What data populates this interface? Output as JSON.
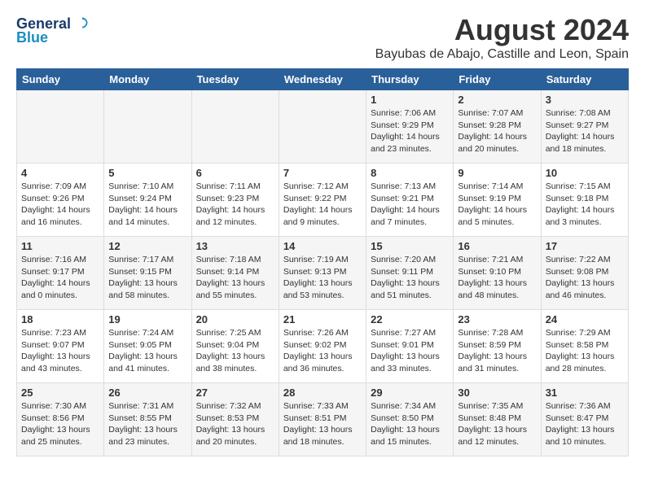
{
  "logo": {
    "line1": "General",
    "line2": "Blue"
  },
  "title": "August 2024",
  "subtitle": "Bayubas de Abajo, Castille and Leon, Spain",
  "days_of_week": [
    "Sunday",
    "Monday",
    "Tuesday",
    "Wednesday",
    "Thursday",
    "Friday",
    "Saturday"
  ],
  "weeks": [
    [
      {
        "day": "",
        "info": ""
      },
      {
        "day": "",
        "info": ""
      },
      {
        "day": "",
        "info": ""
      },
      {
        "day": "",
        "info": ""
      },
      {
        "day": "1",
        "info": "Sunrise: 7:06 AM\nSunset: 9:29 PM\nDaylight: 14 hours\nand 23 minutes."
      },
      {
        "day": "2",
        "info": "Sunrise: 7:07 AM\nSunset: 9:28 PM\nDaylight: 14 hours\nand 20 minutes."
      },
      {
        "day": "3",
        "info": "Sunrise: 7:08 AM\nSunset: 9:27 PM\nDaylight: 14 hours\nand 18 minutes."
      }
    ],
    [
      {
        "day": "4",
        "info": "Sunrise: 7:09 AM\nSunset: 9:26 PM\nDaylight: 14 hours\nand 16 minutes."
      },
      {
        "day": "5",
        "info": "Sunrise: 7:10 AM\nSunset: 9:24 PM\nDaylight: 14 hours\nand 14 minutes."
      },
      {
        "day": "6",
        "info": "Sunrise: 7:11 AM\nSunset: 9:23 PM\nDaylight: 14 hours\nand 12 minutes."
      },
      {
        "day": "7",
        "info": "Sunrise: 7:12 AM\nSunset: 9:22 PM\nDaylight: 14 hours\nand 9 minutes."
      },
      {
        "day": "8",
        "info": "Sunrise: 7:13 AM\nSunset: 9:21 PM\nDaylight: 14 hours\nand 7 minutes."
      },
      {
        "day": "9",
        "info": "Sunrise: 7:14 AM\nSunset: 9:19 PM\nDaylight: 14 hours\nand 5 minutes."
      },
      {
        "day": "10",
        "info": "Sunrise: 7:15 AM\nSunset: 9:18 PM\nDaylight: 14 hours\nand 3 minutes."
      }
    ],
    [
      {
        "day": "11",
        "info": "Sunrise: 7:16 AM\nSunset: 9:17 PM\nDaylight: 14 hours\nand 0 minutes."
      },
      {
        "day": "12",
        "info": "Sunrise: 7:17 AM\nSunset: 9:15 PM\nDaylight: 13 hours\nand 58 minutes."
      },
      {
        "day": "13",
        "info": "Sunrise: 7:18 AM\nSunset: 9:14 PM\nDaylight: 13 hours\nand 55 minutes."
      },
      {
        "day": "14",
        "info": "Sunrise: 7:19 AM\nSunset: 9:13 PM\nDaylight: 13 hours\nand 53 minutes."
      },
      {
        "day": "15",
        "info": "Sunrise: 7:20 AM\nSunset: 9:11 PM\nDaylight: 13 hours\nand 51 minutes."
      },
      {
        "day": "16",
        "info": "Sunrise: 7:21 AM\nSunset: 9:10 PM\nDaylight: 13 hours\nand 48 minutes."
      },
      {
        "day": "17",
        "info": "Sunrise: 7:22 AM\nSunset: 9:08 PM\nDaylight: 13 hours\nand 46 minutes."
      }
    ],
    [
      {
        "day": "18",
        "info": "Sunrise: 7:23 AM\nSunset: 9:07 PM\nDaylight: 13 hours\nand 43 minutes."
      },
      {
        "day": "19",
        "info": "Sunrise: 7:24 AM\nSunset: 9:05 PM\nDaylight: 13 hours\nand 41 minutes."
      },
      {
        "day": "20",
        "info": "Sunrise: 7:25 AM\nSunset: 9:04 PM\nDaylight: 13 hours\nand 38 minutes."
      },
      {
        "day": "21",
        "info": "Sunrise: 7:26 AM\nSunset: 9:02 PM\nDaylight: 13 hours\nand 36 minutes."
      },
      {
        "day": "22",
        "info": "Sunrise: 7:27 AM\nSunset: 9:01 PM\nDaylight: 13 hours\nand 33 minutes."
      },
      {
        "day": "23",
        "info": "Sunrise: 7:28 AM\nSunset: 8:59 PM\nDaylight: 13 hours\nand 31 minutes."
      },
      {
        "day": "24",
        "info": "Sunrise: 7:29 AM\nSunset: 8:58 PM\nDaylight: 13 hours\nand 28 minutes."
      }
    ],
    [
      {
        "day": "25",
        "info": "Sunrise: 7:30 AM\nSunset: 8:56 PM\nDaylight: 13 hours\nand 25 minutes."
      },
      {
        "day": "26",
        "info": "Sunrise: 7:31 AM\nSunset: 8:55 PM\nDaylight: 13 hours\nand 23 minutes."
      },
      {
        "day": "27",
        "info": "Sunrise: 7:32 AM\nSunset: 8:53 PM\nDaylight: 13 hours\nand 20 minutes."
      },
      {
        "day": "28",
        "info": "Sunrise: 7:33 AM\nSunset: 8:51 PM\nDaylight: 13 hours\nand 18 minutes."
      },
      {
        "day": "29",
        "info": "Sunrise: 7:34 AM\nSunset: 8:50 PM\nDaylight: 13 hours\nand 15 minutes."
      },
      {
        "day": "30",
        "info": "Sunrise: 7:35 AM\nSunset: 8:48 PM\nDaylight: 13 hours\nand 12 minutes."
      },
      {
        "day": "31",
        "info": "Sunrise: 7:36 AM\nSunset: 8:47 PM\nDaylight: 13 hours\nand 10 minutes."
      }
    ]
  ]
}
